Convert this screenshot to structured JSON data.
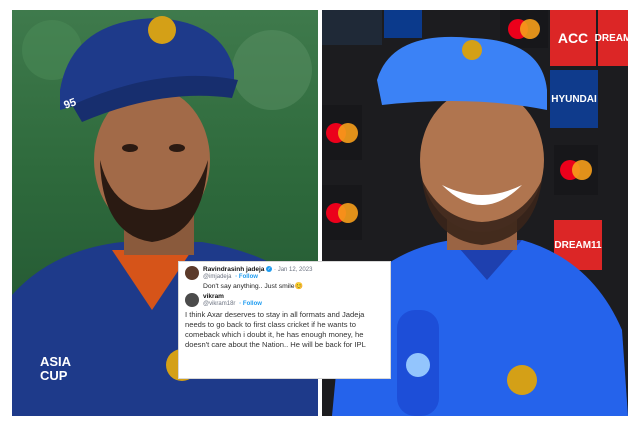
{
  "tweet1": {
    "name": "Ravindrasinh jadeja",
    "date": "· Jan 12, 2023",
    "handle": "@imjadeja",
    "follow": "· Follow",
    "text": "Don't say anything.. Just smile😊"
  },
  "tweet2": {
    "name": "vikram",
    "handle": "@vikram18r",
    "follow": "· Follow",
    "text": "I think Axar deserves to stay in all formats and Jadeja needs to go back to first class cricket if he wants to comeback which i doubt it, he has enough money, he doesn't care about the Nation.. He will be back for IPL"
  },
  "left_photo": {
    "cap_number": "95",
    "jersey_text": "ASIA CUP"
  },
  "right_photo": {
    "boards": [
      "ACC",
      "DREAM",
      "HYUNDAI",
      "mastercard",
      "DREAM11"
    ]
  },
  "colors": {
    "jersey_blue": "#1e40af",
    "cap_blue": "#2563eb",
    "follow_blue": "#1d9bf0"
  }
}
